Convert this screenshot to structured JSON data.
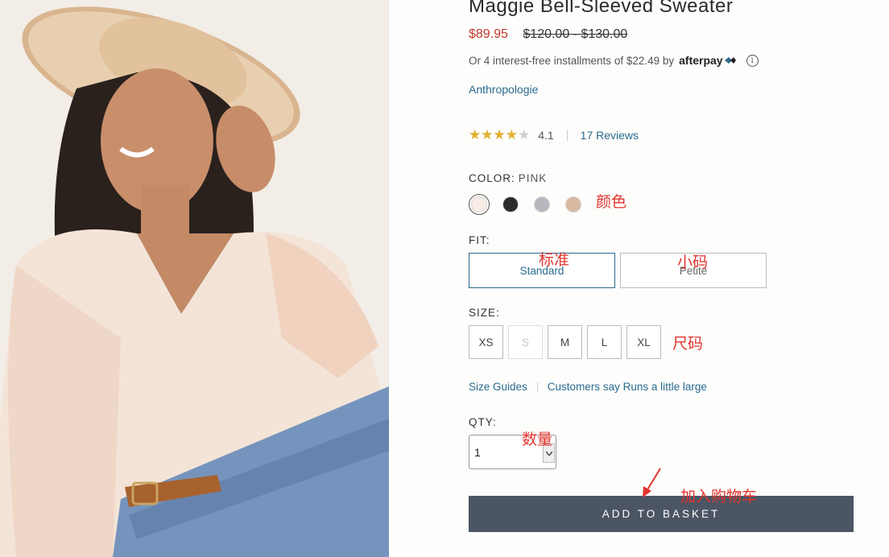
{
  "product": {
    "title": "Maggie Bell-Sleeved Sweater",
    "sale_price": "$89.95",
    "original_price": "$120.00 - $130.00",
    "afterpay_text": "Or 4 interest-free installments of $22.49 by",
    "afterpay_logo": "afterpay",
    "brand": "Anthropologie"
  },
  "rating": {
    "value": "4.1",
    "fraction": 0.82,
    "reviews_label": "17 Reviews"
  },
  "color": {
    "label": "COLOR:",
    "selected": "PINK",
    "swatches": [
      {
        "name": "pink",
        "color": "#f8ece6"
      },
      {
        "name": "black",
        "color": "#2c2c2c"
      },
      {
        "name": "grey",
        "color": "#b6b8bd"
      },
      {
        "name": "oatmeal",
        "color": "#d9b8a0"
      }
    ]
  },
  "fit": {
    "label": "FIT:",
    "options": [
      "Standard",
      "Petite"
    ]
  },
  "size": {
    "label": "SIZE:",
    "options": [
      "XS",
      "S",
      "M",
      "L",
      "XL"
    ]
  },
  "guides": {
    "size_guides": "Size Guides",
    "customers_say": "Customers say Runs a little large"
  },
  "qty": {
    "label": "QTY:",
    "value": "1",
    "arrow": "chevron-down-icon"
  },
  "cta": {
    "add_to_basket": "ADD TO BASKET"
  },
  "annotations": {
    "color": "颜色",
    "standard": "标准",
    "petite": "小码",
    "size": "尺码",
    "qty": "数量",
    "add_to_cart": "加入购物车",
    "accent": "#e2352f"
  },
  "colors": {
    "sale_red": "#c0392b",
    "link_blue": "#2a6b8f",
    "button_slate": "#4b5563",
    "star_gold": "#e3b12f"
  }
}
